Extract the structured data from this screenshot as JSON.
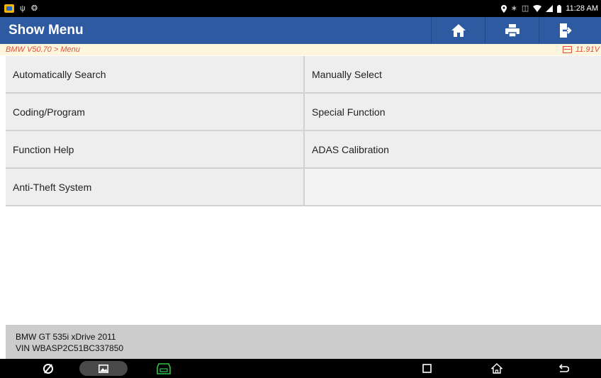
{
  "status_bar": {
    "time": "11:28 AM",
    "left_icons": [
      "app-notification-icon",
      "usb-icon",
      "nfc-icon"
    ],
    "right_icons": [
      "location-icon",
      "bluetooth-icon",
      "vibrate-icon",
      "wifi-icon",
      "cellular-icon",
      "battery-icon"
    ]
  },
  "header": {
    "title": "Show Menu",
    "buttons": [
      {
        "name": "home-button",
        "icon": "home-icon"
      },
      {
        "name": "print-button",
        "icon": "print-icon"
      },
      {
        "name": "exit-button",
        "icon": "exit-icon"
      }
    ],
    "color": "#2d5aa0"
  },
  "breadcrumb": {
    "path": "BMW V50.70 > Menu",
    "voltage": "11.91V",
    "color": "#e0503a"
  },
  "menu": {
    "items": [
      "Automatically Search",
      "Manually Select",
      "Coding/Program",
      "Special Function",
      "Function Help",
      "ADAS Calibration",
      "Anti-Theft System"
    ]
  },
  "vehicle": {
    "model": "BMW GT 535i xDrive 2011",
    "vin": "VIN WBASP2C51BC337850"
  },
  "nav_bar": {
    "icons": [
      "browser-icon",
      "gallery-icon",
      "vci-icon",
      "recent-apps-icon",
      "home-nav-icon",
      "back-icon"
    ],
    "vci_color": "#35c24a"
  }
}
